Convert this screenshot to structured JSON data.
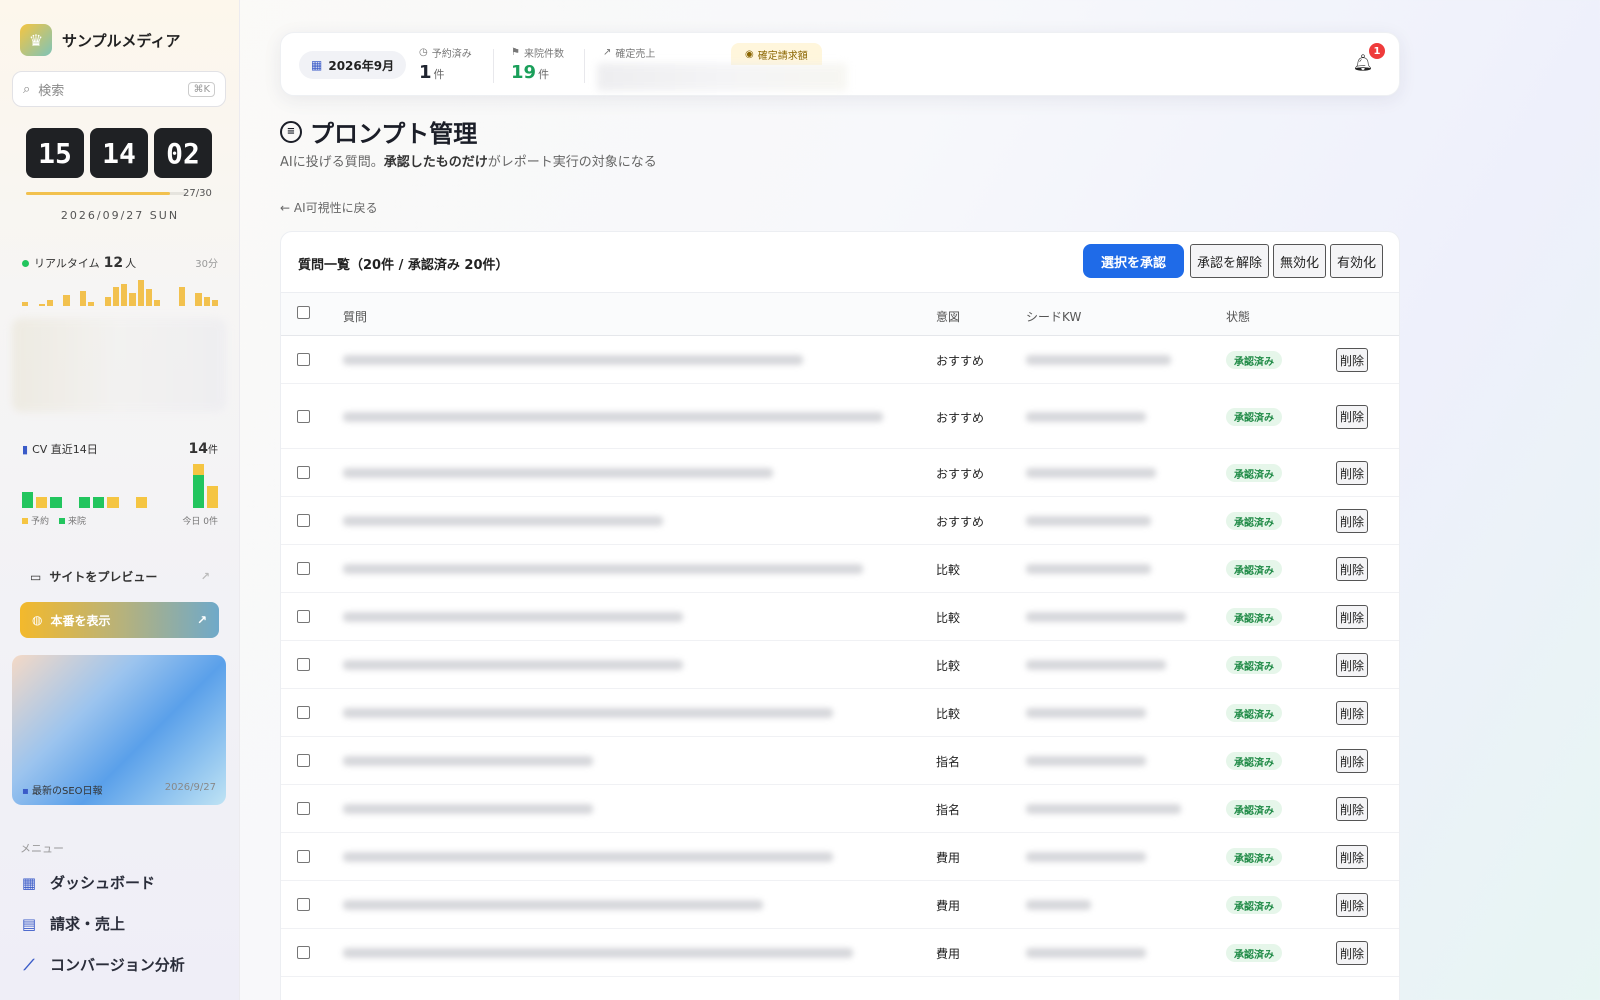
{
  "sidebar": {
    "brand": "サンプルメディア",
    "search_placeholder": "検索",
    "search_shortcut": "⌘K",
    "clock": {
      "h": "15",
      "m": "14",
      "s": "02"
    },
    "month_progress": {
      "current": 27,
      "total": 30,
      "label": "27/30"
    },
    "date": "2026/09/27 SUN",
    "realtime": {
      "label": "リアルタイム",
      "count": "12",
      "unit": "人",
      "window": "30分",
      "bars": [
        2,
        0,
        1,
        3,
        0,
        5,
        0,
        7,
        2,
        0,
        4,
        9,
        10,
        6,
        12,
        8,
        3,
        0,
        0,
        9,
        0,
        6,
        4,
        3
      ]
    },
    "cv": {
      "label": "CV 直近14日",
      "total": "14",
      "unit": "件",
      "legend_reserve": "予約",
      "legend_visit": "来院",
      "today": "今日 0件",
      "days": [
        {
          "r": 0,
          "v": 3
        },
        {
          "r": 2,
          "v": 0
        },
        {
          "r": 0,
          "v": 2
        },
        {
          "r": 0,
          "v": 0
        },
        {
          "r": 0,
          "v": 2
        },
        {
          "r": 0,
          "v": 2
        },
        {
          "r": 2,
          "v": 0
        },
        {
          "r": 0,
          "v": 0
        },
        {
          "r": 2,
          "v": 0
        },
        {
          "r": 0,
          "v": 0
        },
        {
          "r": 0,
          "v": 0
        },
        {
          "r": 0,
          "v": 0
        },
        {
          "r": 2,
          "v": 6
        },
        {
          "r": 4,
          "v": 0
        }
      ]
    },
    "preview_label": "サイトをプレビュー",
    "production_label": "本番を表示",
    "seo_report": {
      "label": "最新のSEO日報",
      "date": "2026/9/27"
    },
    "menu_heading": "メニュー",
    "menu": [
      {
        "label": "ダッシュボード",
        "icon": "grid-icon"
      },
      {
        "label": "請求・売上",
        "icon": "receipt-icon"
      },
      {
        "label": "コンバージョン分析",
        "icon": "chart-line-icon"
      }
    ]
  },
  "topbar": {
    "month": "2026年9月",
    "reserved": {
      "label": "予約済み",
      "value": "1",
      "unit": "件"
    },
    "visits": {
      "label": "来院件数",
      "value": "19",
      "unit": "件"
    },
    "revenue": {
      "label": "確定売上"
    },
    "billed": {
      "label": "確定請求額"
    },
    "notifications": "1"
  },
  "page": {
    "title": "プロンプト管理",
    "subtitle_pre": "AIに投げる質問。",
    "subtitle_bold": "承認したものだけ",
    "subtitle_post": "がレポート実行の対象になる",
    "back": "← AI可視性に戻る"
  },
  "table": {
    "title": "質問一覧（20件 / 承認済み 20件）",
    "actions": {
      "approve": "選択を承認",
      "unapprove": "承認を解除",
      "disable": "無効化",
      "enable": "有効化"
    },
    "headers": {
      "question": "質問",
      "intent": "意図",
      "keyword": "シードKW",
      "status": "状態"
    },
    "rows": [
      {
        "intent": "おすすめ",
        "status": "承認済み",
        "delete": "削除"
      },
      {
        "intent": "おすすめ",
        "status": "承認済み",
        "delete": "削除"
      },
      {
        "intent": "おすすめ",
        "status": "承認済み",
        "delete": "削除"
      },
      {
        "intent": "おすすめ",
        "status": "承認済み",
        "delete": "削除"
      },
      {
        "intent": "比較",
        "status": "承認済み",
        "delete": "削除"
      },
      {
        "intent": "比較",
        "status": "承認済み",
        "delete": "削除"
      },
      {
        "intent": "比較",
        "status": "承認済み",
        "delete": "削除"
      },
      {
        "intent": "比較",
        "status": "承認済み",
        "delete": "削除"
      },
      {
        "intent": "指名",
        "status": "承認済み",
        "delete": "削除"
      },
      {
        "intent": "指名",
        "status": "承認済み",
        "delete": "削除"
      },
      {
        "intent": "費用",
        "status": "承認済み",
        "delete": "削除"
      },
      {
        "intent": "費用",
        "status": "承認済み",
        "delete": "削除"
      },
      {
        "intent": "費用",
        "status": "承認済み",
        "delete": "削除"
      }
    ]
  }
}
